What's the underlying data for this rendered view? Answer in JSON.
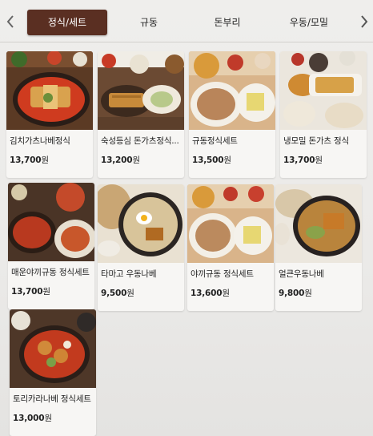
{
  "tabs": {
    "items": [
      {
        "label": "정식/세트",
        "active": true
      },
      {
        "label": "규동",
        "active": false
      },
      {
        "label": "돈부리",
        "active": false
      },
      {
        "label": "우동/모밀",
        "active": false
      }
    ],
    "left_icon": "chevron-left-icon",
    "right_icon": "chevron-right-icon"
  },
  "menu": {
    "currency": "원",
    "items": [
      {
        "name": "김치가츠나베정식",
        "price": "13,700"
      },
      {
        "name": "숙성등심 돈가츠정식...",
        "price": "13,200"
      },
      {
        "name": "규동정식세트",
        "price": "13,500"
      },
      {
        "name": "냉모밀 돈가츠 정식",
        "price": "13,700"
      },
      {
        "name": "매운야끼규동 정식세트",
        "price": "13,700"
      },
      {
        "name": "타마고 우동나베",
        "price": "9,500"
      },
      {
        "name": "야끼규동 정식세트",
        "price": "13,600"
      },
      {
        "name": "얼큰우동나베",
        "price": "9,800"
      },
      {
        "name": "토리카라나베 정식세트",
        "price": "13,000"
      }
    ]
  },
  "colors": {
    "active_tab": "#5a2f22",
    "card": "#f7f6f4",
    "background": "#efeeec"
  }
}
